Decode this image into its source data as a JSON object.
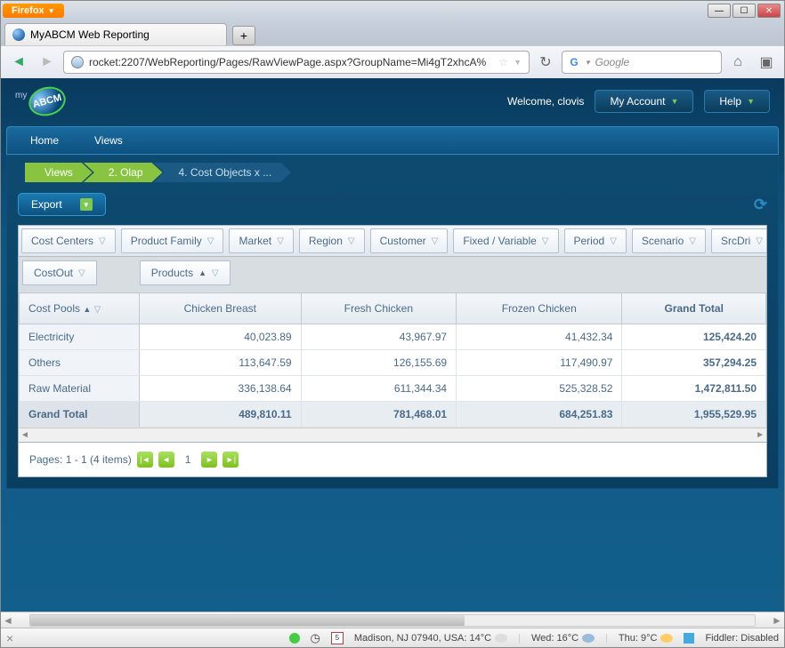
{
  "browser": {
    "name": "Firefox",
    "tab_title": "MyABCM Web Reporting",
    "url": "rocket:2207/WebReporting/Pages/RawViewPage.aspx?GroupName=Mi4gT2xhcA%",
    "search_placeholder": "Google"
  },
  "header": {
    "welcome": "Welcome, clovis",
    "account_label": "My Account",
    "help_label": "Help"
  },
  "menu": {
    "home": "Home",
    "views": "Views"
  },
  "breadcrumb": [
    "Views",
    "2. Olap",
    "4. Cost Objects x ..."
  ],
  "toolbar": {
    "export_label": "Export"
  },
  "filters": [
    "Cost Centers",
    "Product Family",
    "Market",
    "Region",
    "Customer",
    "Fixed / Variable",
    "Period",
    "Scenario",
    "SrcDri"
  ],
  "pivot": {
    "row_measure": "CostOut",
    "col_field": "Products",
    "row_field": "Cost Pools"
  },
  "columns": [
    "Chicken Breast",
    "Fresh Chicken",
    "Frozen Chicken",
    "Grand Total"
  ],
  "rows": [
    {
      "label": "Electricity",
      "v": [
        "40,023.89",
        "43,967.97",
        "41,432.34",
        "125,424.20"
      ]
    },
    {
      "label": "Others",
      "v": [
        "113,647.59",
        "126,155.69",
        "117,490.97",
        "357,294.25"
      ]
    },
    {
      "label": "Raw Material",
      "v": [
        "336,138.64",
        "611,344.34",
        "525,328.52",
        "1,472,811.50"
      ]
    }
  ],
  "grand_total": {
    "label": "Grand Total",
    "v": [
      "489,810.11",
      "781,468.01",
      "684,251.83",
      "1,955,529.95"
    ]
  },
  "pager": {
    "text": "Pages: 1 - 1 (4 items)",
    "current": "1"
  },
  "statusbar": {
    "cal_day": "5",
    "location": "Madison, NJ 07940, USA: 14°C",
    "wed": "Wed: 16°C",
    "thu": "Thu: 9°C",
    "fiddler": "Fiddler: Disabled"
  },
  "chart_data": {
    "type": "table",
    "title": "Cost Objects — CostOut by Products × Cost Pools",
    "row_dimension": "Cost Pools",
    "column_dimension": "Products",
    "measure": "CostOut",
    "columns": [
      "Chicken Breast",
      "Fresh Chicken",
      "Frozen Chicken"
    ],
    "rows": [
      "Electricity",
      "Others",
      "Raw Material"
    ],
    "values": [
      [
        40023.89,
        43967.97,
        41432.34
      ],
      [
        113647.59,
        126155.69,
        117490.97
      ],
      [
        336138.64,
        611344.34,
        525328.52
      ]
    ],
    "row_totals": [
      125424.2,
      357294.25,
      1472811.5
    ],
    "column_totals": [
      489810.11,
      781468.01,
      684251.83
    ],
    "grand_total": 1955529.95
  }
}
